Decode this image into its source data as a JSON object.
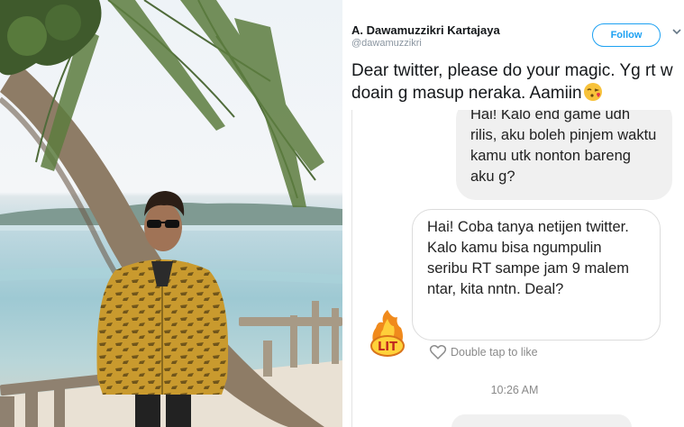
{
  "tweet": {
    "author_name": "A. Dawamuzzikri Kartajaya",
    "author_handle": "@dawamuzzikri",
    "follow_label": "Follow",
    "text": "Dear twitter, please do your magic. Yg rt w doain g masup neraka. Aamiin",
    "emoji": "face-throwing-kiss-icon"
  },
  "chat": {
    "message_1": "Hai! Kalo end game udh rilis, aku boleh pinjem waktu kamu utk nonton bareng aku g?",
    "message_2": "Hai! Coba tanya netijen twitter. Kalo kamu bisa ngumpulin seribu RT sampe jam 9 malem ntar, kita nntn. Deal?",
    "sticker_label": "LIT",
    "like_hint": "Double tap to like",
    "timestamp": "10:26 AM"
  },
  "colors": {
    "accent": "#1da1f2",
    "text": "#14171a",
    "muted": "#8a95a0",
    "bubble": "#f0f0f0"
  }
}
